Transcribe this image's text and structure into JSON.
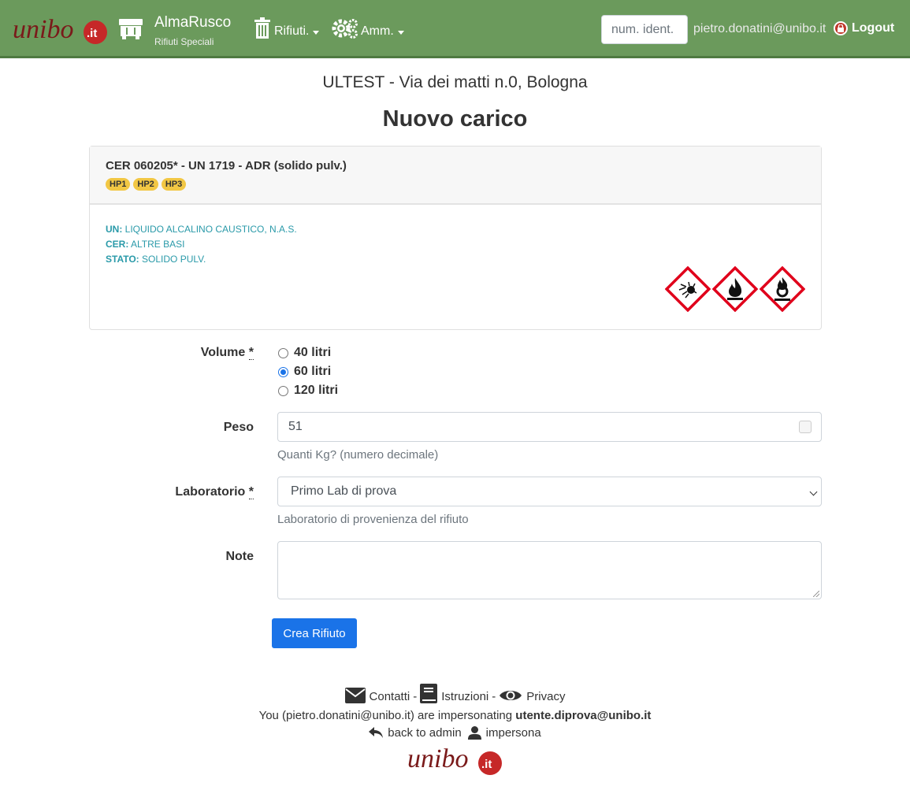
{
  "navbar": {
    "logo_alt": "unibo.it",
    "brand_title": "AlmaRusco",
    "brand_subtitle": "Rifiuti Speciali",
    "menu_rifiuti": "Rifiuti.",
    "menu_amm": "Amm.",
    "search_placeholder": "num. ident.",
    "user_email": "pietro.donatini@unibo.it",
    "logout_label": "Logout"
  },
  "location": "ULTEST - Via dei matti n.0, Bologna",
  "page_title": "Nuovo carico",
  "card": {
    "title": "CER 060205* - UN 1719 - ADR (solido pulv.)",
    "badges": [
      "HP1",
      "HP2",
      "HP3"
    ],
    "info": [
      {
        "key": "UN:",
        "value": "LIQUIDO ALCALINO CAUSTICO, N.A.S."
      },
      {
        "key": "CER:",
        "value": "ALTRE BASI"
      },
      {
        "key": "STATO:",
        "value": "SOLIDO PULV."
      }
    ],
    "hazard_icons": [
      "explosive-ghs-icon",
      "flammable-ghs-icon",
      "oxidizing-ghs-icon"
    ]
  },
  "form": {
    "volume_label": "Volume",
    "required_mark": "*",
    "volume_options": [
      "40 litri",
      "60 litri",
      "120 litri"
    ],
    "volume_selected": "60 litri",
    "peso_label": "Peso",
    "peso_value": "51",
    "peso_help": "Quanti Kg? (numero decimale)",
    "laboratorio_label": "Laboratorio",
    "laboratorio_value": "Primo Lab di prova",
    "laboratorio_help": "Laboratorio di provenienza del rifiuto",
    "note_label": "Note",
    "note_value": "",
    "submit_label": "Crea Rifiuto"
  },
  "footer": {
    "contatti": "Contatti",
    "istruzioni": "Istruzioni",
    "privacy": "Privacy",
    "separator": "-",
    "impersonate_prefix": "You (pietro.donatini@unibo.it) are impersonating",
    "impersonated_user": "utente.diprova@unibo.it",
    "back_to_admin": "back to admin",
    "impersona": "impersona"
  },
  "colors": {
    "navbar": "#6b9a5c",
    "accent": "#1a73e8",
    "badge": "#f2c744",
    "info_text": "#2a9aa9",
    "hazard_red": "#e0001b"
  }
}
